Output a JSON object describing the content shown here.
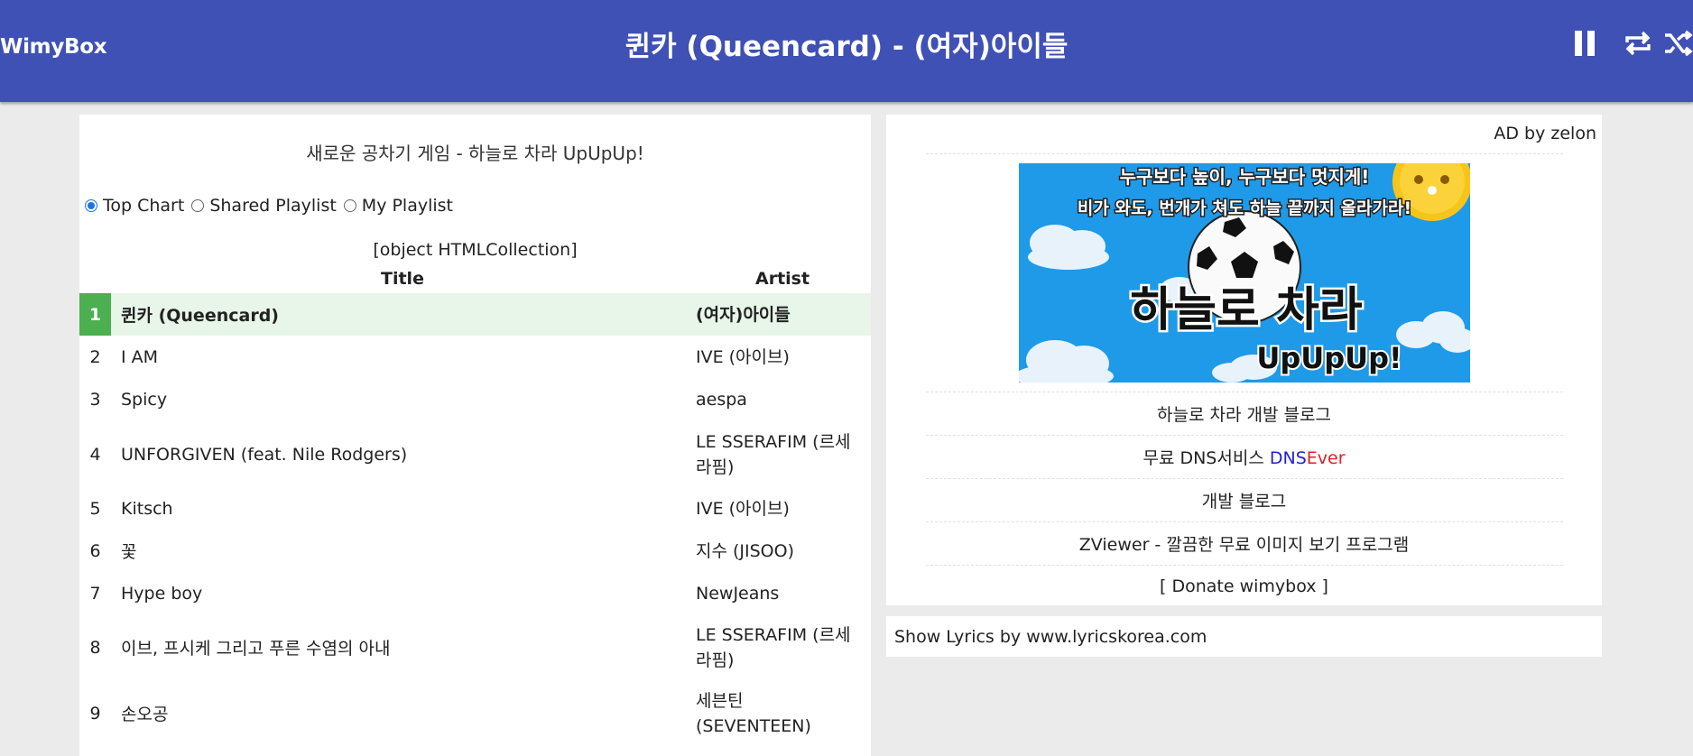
{
  "header": {
    "brand": "WimyBox",
    "now_playing": "퀸카 (Queencard) - (여자)아이들",
    "icons": [
      "pause-icon",
      "repeat-icon",
      "shuffle-icon"
    ],
    "accent_color": "#3f51b5"
  },
  "left": {
    "promo_text": "새로운 공차기 게임 - 하늘로 차라 UpUpUp!",
    "chart_options": [
      {
        "label": "Top Chart",
        "selected": true
      },
      {
        "label": "Shared Playlist",
        "selected": false
      },
      {
        "label": "My Playlist",
        "selected": false
      }
    ],
    "debug_text": "[object HTMLCollection]",
    "table": {
      "col_title": "Title",
      "col_artist": "Artist",
      "rows": [
        {
          "num": "1",
          "title": "퀸카 (Queencard)",
          "artist": "(여자)아이들"
        },
        {
          "num": "2",
          "title": "I AM",
          "artist": "IVE (아이브)"
        },
        {
          "num": "3",
          "title": "Spicy",
          "artist": "aespa"
        },
        {
          "num": "4",
          "title": "UNFORGIVEN (feat. Nile Rodgers)",
          "artist": "LE SSERAFIM (르세라핌)"
        },
        {
          "num": "5",
          "title": "Kitsch",
          "artist": "IVE (아이브)"
        },
        {
          "num": "6",
          "title": "꽃",
          "artist": "지수 (JISOO)"
        },
        {
          "num": "7",
          "title": "Hype boy",
          "artist": "NewJeans"
        },
        {
          "num": "8",
          "title": "이브, 프시케 그리고 푸른 수염의 아내",
          "artist": "LE SSERAFIM (르세라핌)"
        },
        {
          "num": "9",
          "title": "손오공",
          "artist": "세븐틴 (SEVENTEEN)"
        }
      ],
      "active_color": "#4caf50"
    }
  },
  "right": {
    "ad_by": "AD by zelon",
    "banner": {
      "line1": "누구보다 높이, 누구보다 멋지게!",
      "line2": "비가 와도, 번개가 쳐도 하늘 끝까지 올라가라!",
      "title": "하늘로 차라",
      "subtitle": "UpUpUp!"
    },
    "links": {
      "blog": "하늘로 차라 개발 블로그",
      "dns_prefix": "무료 DNS서비스",
      "dns_a": "DNS",
      "dns_b": "Ever",
      "dev_blog": "개발 블로그",
      "zviewer": "ZViewer - 깔끔한 무료 이미지 보기 프로그램",
      "donate": "[ Donate wimybox ]"
    }
  },
  "lyrics": {
    "text": "Show Lyrics by www.lyricskorea.com"
  }
}
